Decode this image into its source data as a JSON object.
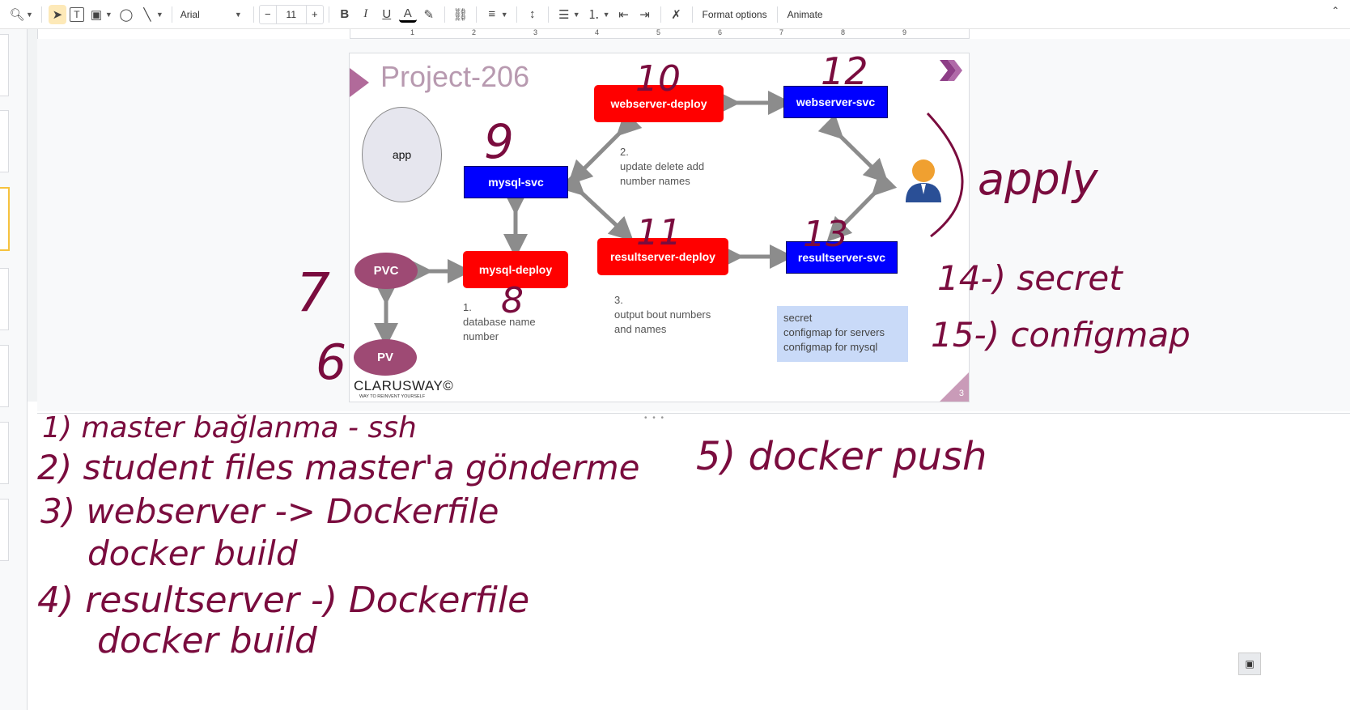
{
  "toolbar": {
    "zoom_icon": "zoom-icon",
    "font": "Arial",
    "font_size": "11",
    "format_options": "Format options",
    "animate": "Animate"
  },
  "slide": {
    "title": "Project-206",
    "app_label": "app",
    "nodes": {
      "webserver_deploy": "webserver-deploy",
      "webserver_svc": "webserver-svc",
      "mysql_svc": "mysql-svc",
      "mysql_deploy": "mysql-deploy",
      "resultserver_deploy": "resultserver-deploy",
      "resultserver_svc": "resultserver-svc",
      "pvc": "PVC",
      "pv": "PV"
    },
    "notes": {
      "step1": "1.\ndatabase name\nnumber",
      "step2": "2.\nupdate delete add\nnumber names",
      "step3": "3.\noutput bout numbers\nand names"
    },
    "legend": "secret\nconfigmap for servers\nconfigmap for mysql",
    "logo": "CLARUSWAY©",
    "logo_sub": "WAY TO REINVENT YOURSELF",
    "page_number": "3",
    "colors": {
      "red": "#ff0000",
      "blue": "#0000ff",
      "maroon": "#9e4a74",
      "ink": "#7a0c3e",
      "legend_bg": "#c9daf8"
    }
  },
  "ruler": {
    "marks": [
      "1",
      "2",
      "3",
      "4",
      "5",
      "6",
      "7",
      "8",
      "9"
    ]
  },
  "handwriting": {
    "n9": "9",
    "n10": "10",
    "n11": "11",
    "n12": "12",
    "n13": "13",
    "n7": "7",
    "n8": "8",
    "n6": "6",
    "apply": "apply",
    "l14": "14-) secret",
    "l15": "15-) configmap",
    "line1": "1) master bağlanma - ssh",
    "line2": "2) student files master'a gönderme",
    "line3": "3) webserver -> Dockerfile",
    "line3b": "docker build",
    "line4": "4) resultserver -) Dockerfile",
    "line4b": "docker build",
    "line5": "5) docker push"
  }
}
